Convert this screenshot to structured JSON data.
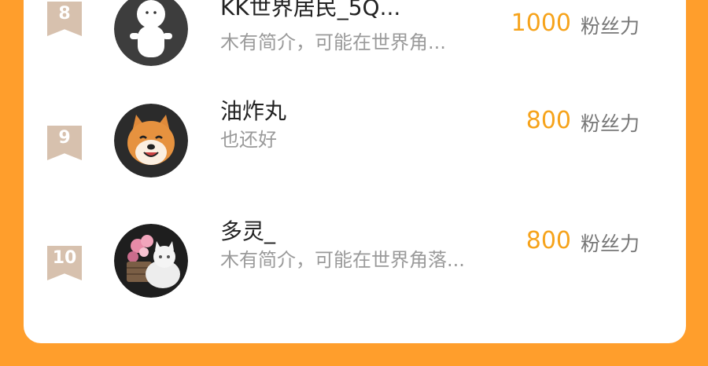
{
  "leaderboard": {
    "unit_label": "粉丝力",
    "colors": {
      "background": "#FF9E2C",
      "score": "#F6A31B",
      "rank_badge": "#D7C1AE"
    },
    "rows": [
      {
        "rank": "8",
        "name": "KK世界居民_5Q...",
        "bio": "木有简介，可能在世界角...",
        "score": "1000",
        "avatar_icon": "default-person-avatar-icon"
      },
      {
        "rank": "9",
        "name": "油炸丸",
        "bio": "也还好",
        "score": "800",
        "avatar_icon": "shiba-dog-avatar-icon"
      },
      {
        "rank": "10",
        "name": "多灵_",
        "bio": "木有简介，可能在世界角落...",
        "score": "800",
        "avatar_icon": "cat-with-flowers-avatar-icon"
      }
    ]
  }
}
